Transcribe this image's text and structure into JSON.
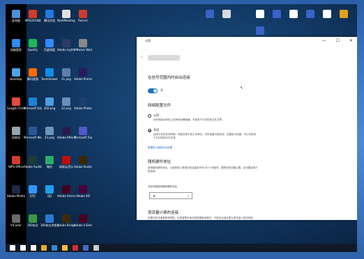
{
  "desktop": {
    "icons_left": [
      {
        "label": "此电脑",
        "color": "#4a90d9"
      },
      {
        "label": "WPS2019网",
        "color": "#d23a2a"
      },
      {
        "label": "腾讯文档",
        "color": "#1f7ae0"
      },
      {
        "label": "NextMeeting",
        "color": "#e0e0e0"
      },
      {
        "label": "Recent",
        "color": "#cf3a2a"
      },
      {
        "label": "电脑管家",
        "color": "#2d8cf0"
      },
      {
        "label": "Spotify",
        "color": "#1db954"
      },
      {
        "label": "百度网盘",
        "color": "#3388ff"
      },
      {
        "label": "Adobe Lightroom",
        "color": "#2f3b64"
      },
      {
        "label": "VMware Workstation",
        "color": "#8a8a8a"
      },
      {
        "label": "Bandizip",
        "color": "#4aa4e8"
      },
      {
        "label": "腾讯视频",
        "color": "#ff6a00"
      },
      {
        "label": "TeamViewer",
        "color": "#0e8ee9"
      },
      {
        "label": "21.png",
        "color": "#5d7fa8"
      },
      {
        "label": "Adobe Premiere",
        "color": "#2a1a5e"
      },
      {
        "label": "Google Chrome",
        "color": "#e24b3a"
      },
      {
        "label": "Microsoft Edge",
        "color": "#1b84d6"
      },
      {
        "label": "360.png",
        "color": "#48a0e8"
      },
      {
        "label": "22.png",
        "color": "#6b8fb8"
      },
      {
        "label": "Adobe Photoshop",
        "color": "#1c3f6e"
      },
      {
        "label": "回收站",
        "color": "#9aa4b0"
      },
      {
        "label": "Microsoft Word",
        "color": "#2b5797"
      },
      {
        "label": "23.png",
        "color": "#6f93bb"
      },
      {
        "label": "Adobe After Effects",
        "color": "#2a1b4f"
      },
      {
        "label": "Microsoft Teams",
        "color": "#5059c9"
      },
      {
        "label": "WPS Office",
        "color": "#d23a2a"
      },
      {
        "label": "Adobe Audition",
        "color": "#1c3d33"
      },
      {
        "label": "微信",
        "color": "#2aae67"
      },
      {
        "label": "网易云音乐",
        "color": "#c20c0c"
      },
      {
        "label": "Adobe Illustrator",
        "color": "#3b2606"
      },
      {
        "label": "Adobe Media Encoder",
        "color": "#1b2a44"
      },
      {
        "label": "钉钉",
        "color": "#3296fa"
      },
      {
        "label": "QQ",
        "color": "#1ea0f0"
      },
      {
        "label": "Adobe Animate",
        "color": "#47001f"
      },
      {
        "label": "Adobe XD",
        "color": "#470137"
      },
      {
        "label": "ViCoder",
        "color": "#6a6a6a"
      },
      {
        "label": "360安全",
        "color": "#3a9a3a"
      },
      {
        "label": "360安全浏览器",
        "color": "#2a7ad0"
      },
      {
        "label": "Adobe Bridge",
        "color": "#3d2a0e"
      },
      {
        "label": "Adobe InDesign",
        "color": "#49021f"
      }
    ],
    "icons_top_right": [
      {
        "color": "#3a63c8"
      },
      {
        "color": "#d8d8e0"
      },
      {
        "color": "#ffffff"
      },
      {
        "color": "#3a63c8"
      },
      {
        "color": "#ffffff"
      },
      {
        "color": "#3a63c8"
      },
      {
        "color": "#ffffff"
      },
      {
        "color": "#e0a020"
      },
      {
        "color": "#3a63c8"
      }
    ]
  },
  "window": {
    "app_title": "设置",
    "controls": "— ☐ ✕",
    "section_auto_connect": "在信号范围内时自动连接",
    "toggle_state": "开",
    "section_network_profile": "网络配置文件",
    "public_option": "公用",
    "public_desc": "你的电脑对网络上的其他设备隐藏，不能用于打印机和文件共享。",
    "private_option": "专用",
    "private_desc": "适用于你信任的网络，例如在家中或工作单位。你的电脑可被发现，如果进行设置，可以将其用于打印机和文件共享。",
    "firewall_link": "配置防火墙和安全设置",
    "section_random_mac": "随机硬件地址",
    "random_mac_desc": "使用随机硬件地址，以使其他人更难在你连接到不同 Wi-Fi 网络时，跟踪你的设备位置。此设置适用于新连接。",
    "random_mac_label": "对此网络使用随机硬件地址",
    "random_mac_value": "关",
    "section_metered": "按流量计费的连接",
    "metered_desc": "如果你的流量套餐有限制，且希望更好地控制数据使用情况，可将此连接设置为按流量计费的网络。"
  },
  "taskbar": {
    "icons": [
      {
        "name": "start",
        "color": "#ffffff"
      },
      {
        "name": "search",
        "color": "#ffffff"
      },
      {
        "name": "task-view",
        "color": "#ffffff"
      },
      {
        "name": "chrome",
        "color": "#e8b030"
      },
      {
        "name": "edge",
        "color": "#2a8ad8"
      },
      {
        "name": "explorer",
        "color": "#f0c040"
      },
      {
        "name": "recorder",
        "color": "#d03030"
      },
      {
        "name": "app",
        "color": "#3a70c0"
      },
      {
        "name": "settings",
        "color": "#cccccc"
      }
    ]
  }
}
